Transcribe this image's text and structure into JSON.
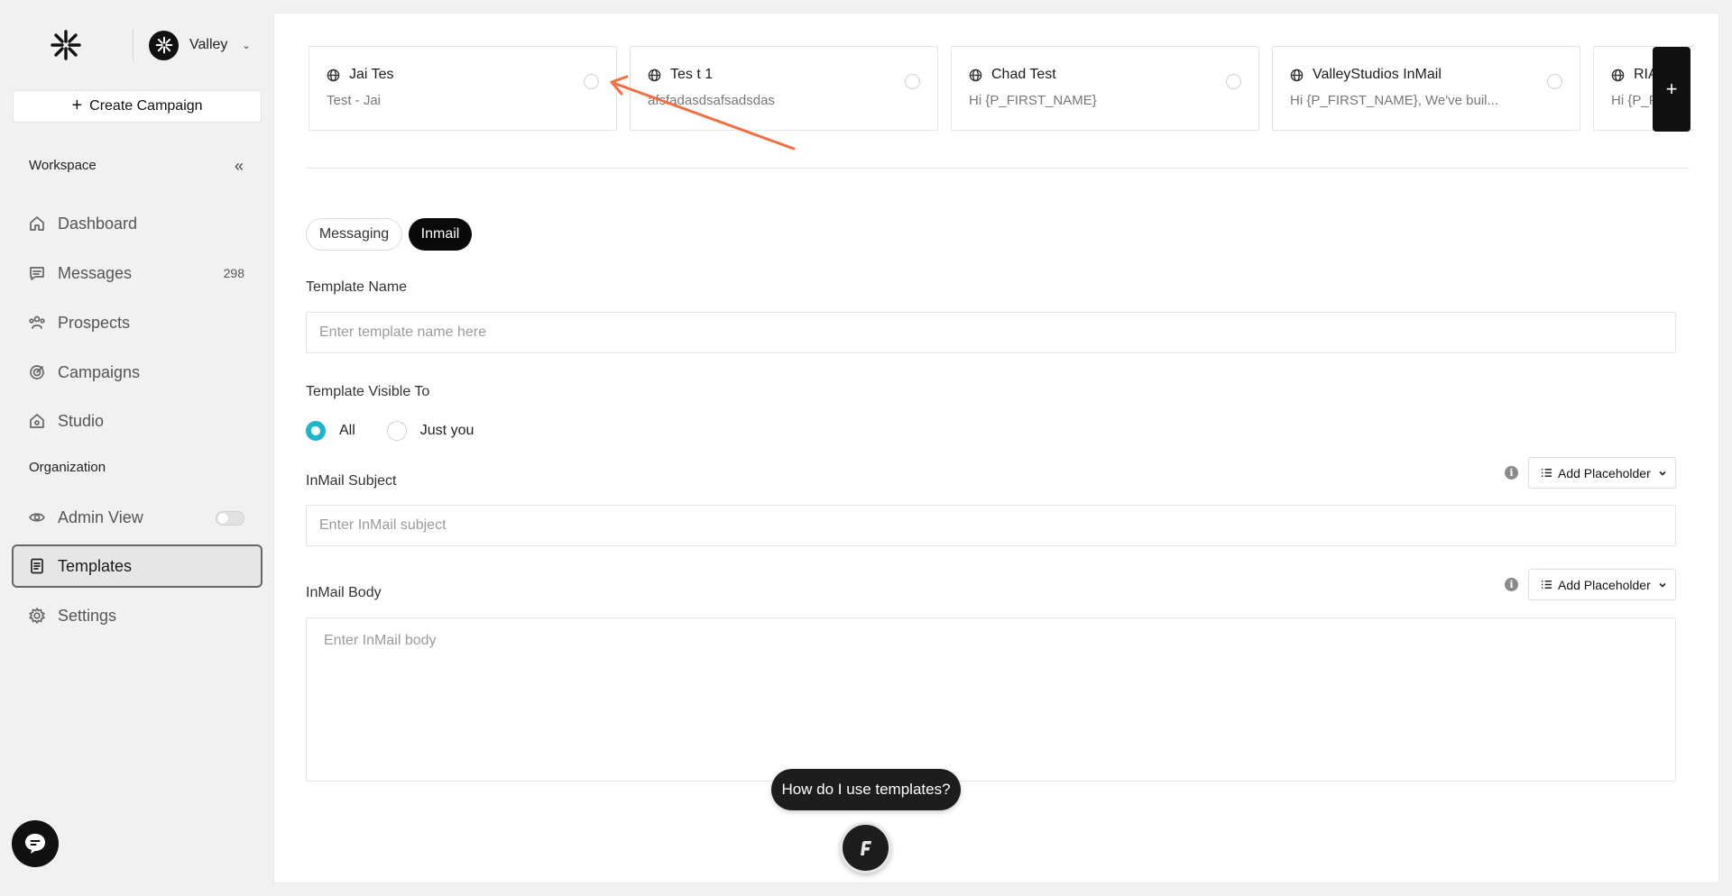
{
  "workspace": {
    "name": "Valley"
  },
  "sidebar": {
    "create_label": "Create Campaign",
    "workspace_label": "Workspace",
    "organization_label": "Organization",
    "items": [
      {
        "label": "Dashboard",
        "icon": "home-icon"
      },
      {
        "label": "Messages",
        "icon": "message-icon",
        "badge": "298"
      },
      {
        "label": "Prospects",
        "icon": "users-icon"
      },
      {
        "label": "Campaigns",
        "icon": "target-icon"
      },
      {
        "label": "Studio",
        "icon": "studio-icon"
      },
      {
        "label": "Admin View",
        "icon": "eye-icon",
        "toggle": false
      },
      {
        "label": "Templates",
        "icon": "document-icon",
        "active": true
      },
      {
        "label": "Settings",
        "icon": "gear-icon"
      }
    ]
  },
  "templates": [
    {
      "title": "Jai Tes",
      "subtitle": "Test - Jai"
    },
    {
      "title": "Tes t 1",
      "subtitle": "afsfadasdsafsadsdas"
    },
    {
      "title": "Chad Test",
      "subtitle": "Hi {P_FIRST_NAME}"
    },
    {
      "title": "ValleyStudios InMail",
      "subtitle": "Hi {P_FIRST_NAME}, We've buil..."
    },
    {
      "title": "RIA",
      "subtitle": "Hi {P_F"
    }
  ],
  "add_template_label": "+",
  "tabs": {
    "messaging": "Messaging",
    "inmail": "Inmail",
    "active": "inmail"
  },
  "form": {
    "name_label": "Template Name",
    "name_placeholder": "Enter template name here",
    "visibility_label": "Template Visible To",
    "visibility_options": [
      "All",
      "Just you"
    ],
    "visibility_selected": "All",
    "subject_label": "InMail Subject",
    "subject_placeholder": "Enter InMail subject",
    "body_label": "InMail Body",
    "body_placeholder": "Enter InMail body",
    "placeholder_button": "Add Placeholder"
  },
  "help": {
    "prompt": "How do I use templates?"
  },
  "colors": {
    "accent": "#1cb5c9",
    "annotation_arrow": "#f07040",
    "primary": "#0a0a0a"
  }
}
